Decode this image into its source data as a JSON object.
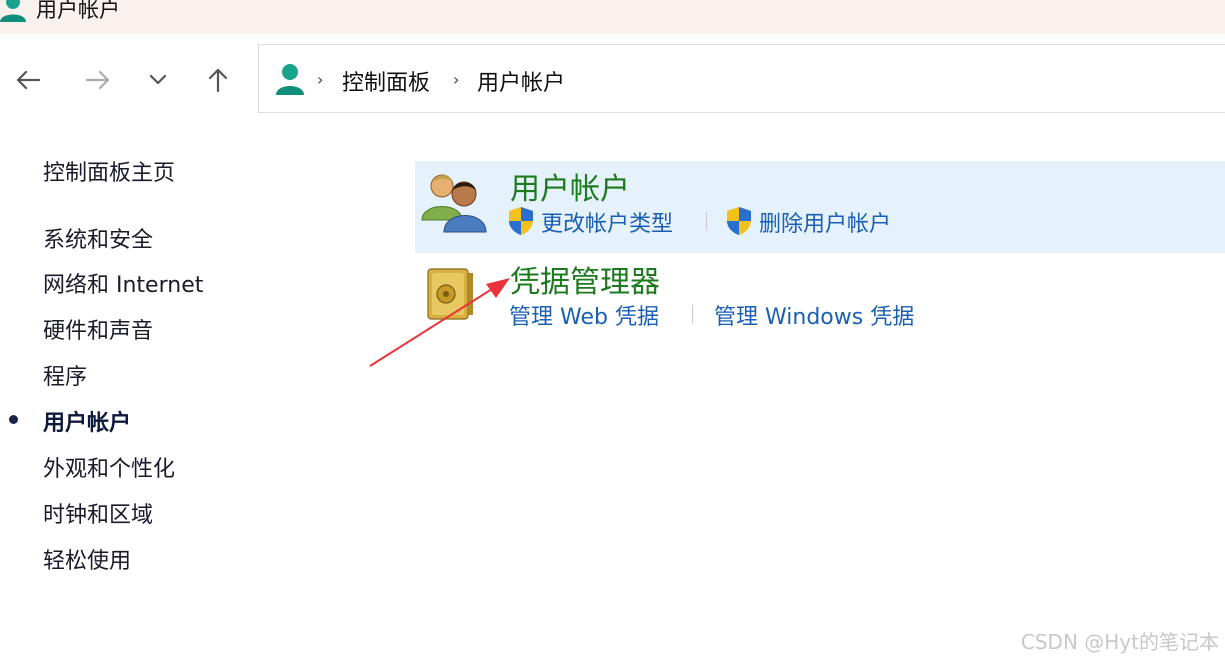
{
  "window": {
    "title": "用户帐户"
  },
  "nav": {
    "back_icon": "arrow-left-icon",
    "forward_icon": "arrow-right-icon",
    "recent_icon": "chevron-down-icon",
    "up_icon": "arrow-up-icon"
  },
  "address": {
    "icon": "user-account-icon",
    "crumbs": [
      "控制面板",
      "用户帐户"
    ]
  },
  "sidebar": {
    "home": "控制面板主页",
    "items": [
      {
        "label": "系统和安全",
        "active": false
      },
      {
        "label": "网络和 Internet",
        "active": false
      },
      {
        "label": "硬件和声音",
        "active": false
      },
      {
        "label": "程序",
        "active": false
      },
      {
        "label": "用户帐户",
        "active": true
      },
      {
        "label": "外观和个性化",
        "active": false
      },
      {
        "label": "时钟和区域",
        "active": false
      },
      {
        "label": "轻松使用",
        "active": false
      }
    ]
  },
  "main": {
    "groups": [
      {
        "title": "用户帐户",
        "icon": "users-icon",
        "links": [
          "更改帐户类型",
          "删除用户帐户"
        ]
      },
      {
        "title": "凭据管理器",
        "icon": "safe-icon",
        "links": [
          "管理 Web 凭据",
          "管理 Windows 凭据"
        ]
      }
    ]
  },
  "annotation": {
    "arrow_color": "#e8343a"
  },
  "colors": {
    "group_title": "#1e7a1e",
    "link": "#1a5fb4",
    "highlight_bg": "#e5f1fb"
  },
  "watermark": "CSDN @Hyt的笔记本"
}
